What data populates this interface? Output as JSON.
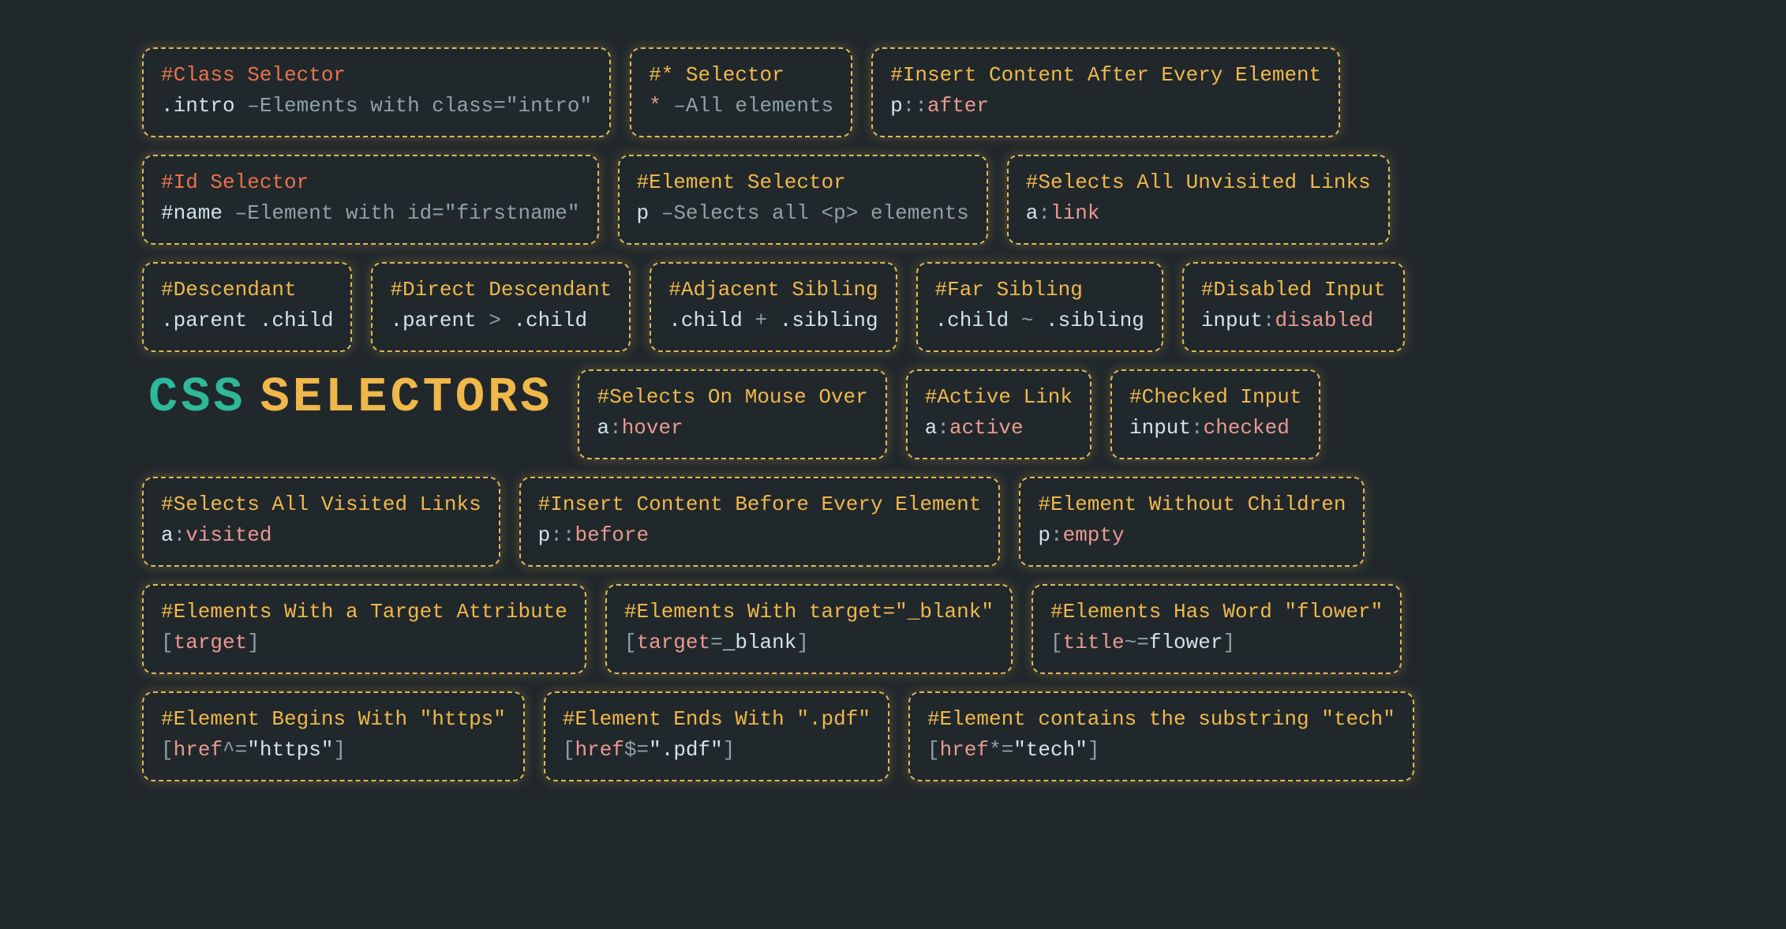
{
  "hero": {
    "css": "CSS",
    "selectors": "SELECTORS"
  },
  "rows": [
    [
      {
        "title_style": "red",
        "title": "#Class Selector",
        "segments": [
          [
            ".intro",
            "sel"
          ],
          [
            "  ",
            ""
          ],
          [
            "–Elements with class=\"intro\"",
            "comment"
          ]
        ]
      },
      {
        "title": "#* Selector",
        "segments": [
          [
            "*",
            "star"
          ],
          [
            "   ",
            ""
          ],
          [
            "–All elements",
            "comment"
          ]
        ]
      },
      {
        "title": "#Insert Content After Every Element",
        "segments": [
          [
            "p",
            "sel"
          ],
          [
            "::",
            "punct"
          ],
          [
            "after",
            "pseudo"
          ]
        ]
      }
    ],
    [
      {
        "title_style": "red",
        "title": "#Id Selector",
        "segments": [
          [
            "#name",
            "sel"
          ],
          [
            "   ",
            ""
          ],
          [
            "–Element with id=\"firstname\"",
            "comment"
          ]
        ]
      },
      {
        "title": "#Element Selector",
        "segments": [
          [
            "p",
            "sel"
          ],
          [
            "   ",
            ""
          ],
          [
            "–Selects all <p> elements",
            "comment"
          ]
        ]
      },
      {
        "title": "#Selects All Unvisited Links",
        "segments": [
          [
            "a",
            "sel"
          ],
          [
            ":",
            "punct"
          ],
          [
            "link",
            "pseudo"
          ]
        ]
      }
    ],
    [
      {
        "title": "#Descendant",
        "segments": [
          [
            ".parent .child",
            "sel"
          ]
        ]
      },
      {
        "title": "#Direct Descendant",
        "segments": [
          [
            ".parent ",
            "sel"
          ],
          [
            ">",
            "punct"
          ],
          [
            " .child",
            "sel"
          ]
        ]
      },
      {
        "title": "#Adjacent Sibling",
        "segments": [
          [
            ".child ",
            "sel"
          ],
          [
            "+",
            "punct"
          ],
          [
            " .sibling",
            "sel"
          ]
        ]
      },
      {
        "title": "#Far Sibling",
        "segments": [
          [
            ".child ",
            "sel"
          ],
          [
            "~",
            "punct"
          ],
          [
            " .sibling",
            "sel"
          ]
        ]
      },
      {
        "title": "#Disabled Input",
        "segments": [
          [
            "input",
            "sel"
          ],
          [
            ":",
            "punct"
          ],
          [
            "disabled",
            "pseudo"
          ]
        ]
      }
    ],
    [
      {
        "hero": true
      },
      {
        "title": "#Selects On Mouse Over",
        "segments": [
          [
            "a",
            "sel"
          ],
          [
            ":",
            "punct"
          ],
          [
            "hover",
            "pseudo"
          ]
        ]
      },
      {
        "title": "#Active Link",
        "segments": [
          [
            "a",
            "sel"
          ],
          [
            ":",
            "punct"
          ],
          [
            "active",
            "pseudo"
          ]
        ]
      },
      {
        "title": "#Checked Input",
        "segments": [
          [
            "input",
            "sel"
          ],
          [
            ":",
            "punct"
          ],
          [
            "checked",
            "pseudo"
          ]
        ]
      }
    ],
    [
      {
        "title": "#Selects All Visited Links",
        "segments": [
          [
            "a",
            "sel"
          ],
          [
            ":",
            "punct"
          ],
          [
            "visited",
            "pseudo"
          ]
        ]
      },
      {
        "title": "#Insert Content Before Every Element",
        "segments": [
          [
            "p",
            "sel"
          ],
          [
            "::",
            "punct"
          ],
          [
            "before",
            "pseudo"
          ]
        ]
      },
      {
        "title": "#Element Without Children",
        "segments": [
          [
            "p",
            "sel"
          ],
          [
            ":",
            "punct"
          ],
          [
            "empty",
            "pseudo"
          ]
        ]
      }
    ],
    [
      {
        "title": "#Elements With a Target Attribute",
        "segments": [
          [
            "[",
            "punct"
          ],
          [
            "target",
            "pseudo"
          ],
          [
            "]",
            "punct"
          ]
        ]
      },
      {
        "title": "#Elements With target=\"_blank\"",
        "segments": [
          [
            "[",
            "punct"
          ],
          [
            "target",
            "pseudo"
          ],
          [
            "=",
            "punct"
          ],
          [
            "_blank",
            "sel"
          ],
          [
            "]",
            "punct"
          ]
        ]
      },
      {
        "title": "#Elements Has Word \"flower\"",
        "segments": [
          [
            "[",
            "punct"
          ],
          [
            "title",
            "pseudo"
          ],
          [
            "~=",
            "punct"
          ],
          [
            "flower",
            "sel"
          ],
          [
            "]",
            "punct"
          ]
        ]
      }
    ],
    [
      {
        "title": "#Element Begins With \"https\"",
        "segments": [
          [
            "[",
            "punct"
          ],
          [
            "href",
            "pseudo"
          ],
          [
            "^=",
            "punct"
          ],
          [
            "\"https\"",
            "sel"
          ],
          [
            "]",
            "punct"
          ]
        ]
      },
      {
        "title": "#Element Ends With \".pdf\"",
        "segments": [
          [
            "[",
            "punct"
          ],
          [
            "href",
            "pseudo"
          ],
          [
            "$=",
            "punct"
          ],
          [
            "\".pdf\"",
            "sel"
          ],
          [
            "]",
            "punct"
          ]
        ]
      },
      {
        "title": "#Element contains the substring \"tech\"",
        "segments": [
          [
            "[",
            "punct"
          ],
          [
            "href",
            "pseudo"
          ],
          [
            "*=",
            "punct"
          ],
          [
            "\"tech\"",
            "sel"
          ],
          [
            "]",
            "punct"
          ]
        ]
      }
    ]
  ]
}
